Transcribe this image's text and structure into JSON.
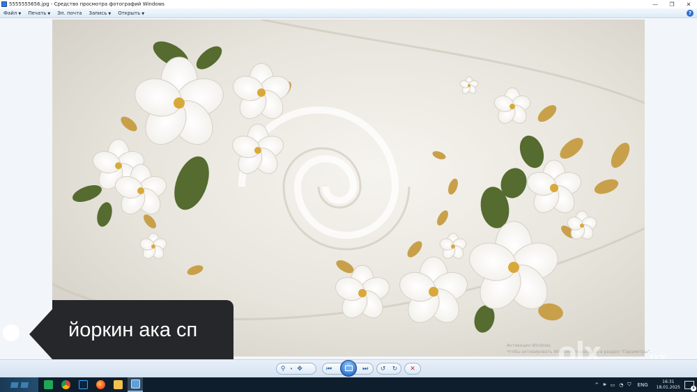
{
  "window": {
    "title": "5555555656.jpg - Средство просмотра фотографий Windows",
    "controls": {
      "minimize": "—",
      "maximize": "❐",
      "close": "✕"
    }
  },
  "menu": {
    "items": [
      "Файл",
      "Печать",
      "Эл. почта",
      "Запись",
      "Открыть"
    ],
    "help_icon": "help-icon"
  },
  "photo": {
    "overlay_caption": "йоркин ака сп",
    "watermark": "olx",
    "watermark_suffix": ".uz",
    "activation_line1": "Активация Windows",
    "activation_line2": "Чтобы активировать Windows, перейдите в раздел \"Параметры\"."
  },
  "toolbar": {
    "zoom": "zoom-icon",
    "fit": "actual-size-icon",
    "previous": "previous-icon",
    "slideshow": "slideshow-icon",
    "next": "next-icon",
    "rotate_left": "rotate-ccw-icon",
    "rotate_right": "rotate-cw-icon",
    "delete": "delete-icon"
  },
  "taskbar": {
    "apps": [
      "whatsapp",
      "chrome",
      "photoshop",
      "firefox",
      "file-explorer",
      "photo-viewer"
    ],
    "language": "ENG",
    "time": "16:31",
    "date": "18.01.2025",
    "notifications": "4"
  },
  "colors": {
    "accent": "#2f74d0",
    "caption_bg": "#26272a",
    "taskbar_bg": "#0f1e2c"
  }
}
